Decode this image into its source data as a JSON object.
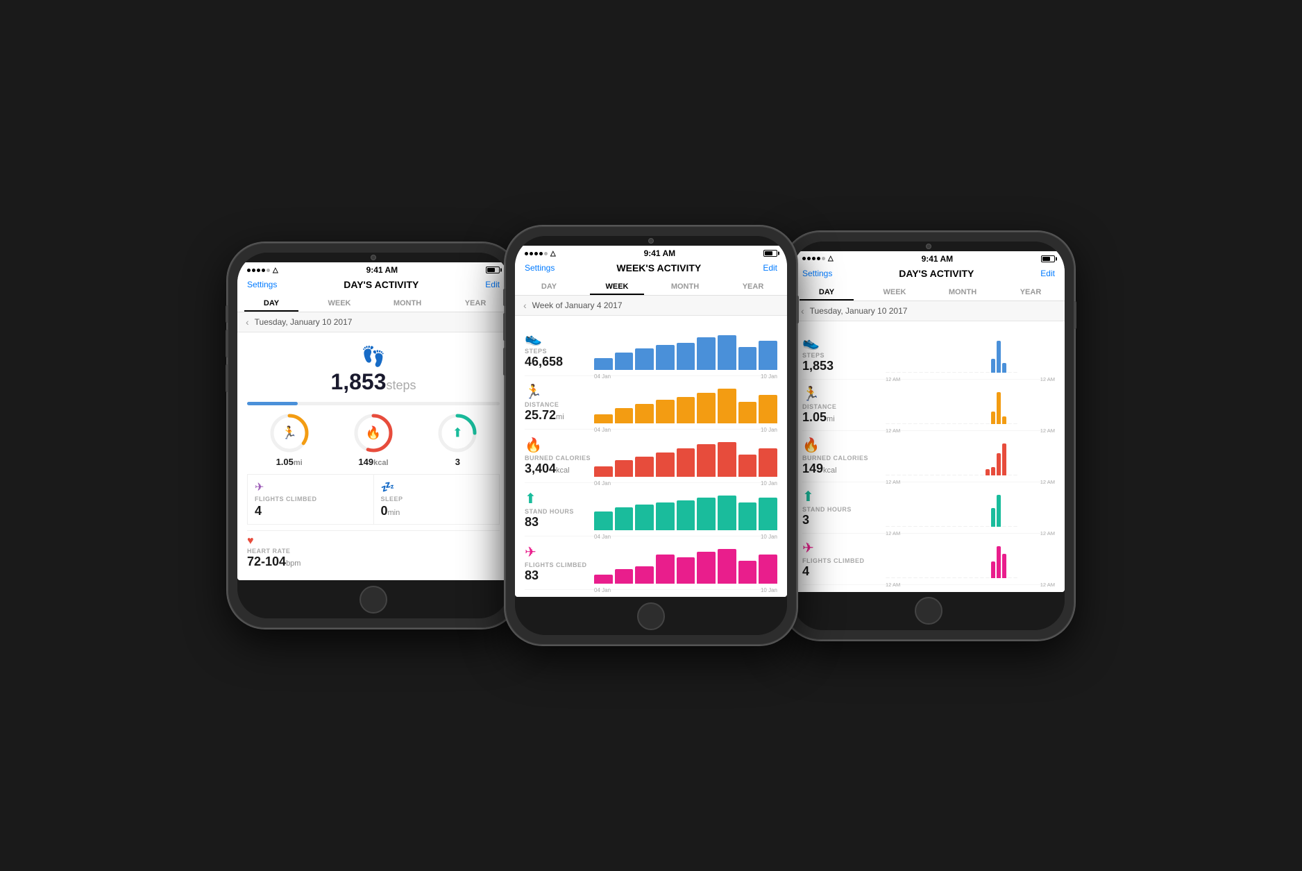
{
  "phones": [
    {
      "id": "phone1",
      "statusBar": {
        "dots": 5,
        "wifi": "WiFi",
        "time": "9:41 AM",
        "battery": 70
      },
      "nav": {
        "settings": "Settings",
        "title": "DAY'S ACTIVITY",
        "edit": "Edit"
      },
      "tabs": [
        "DAY",
        "WEEK",
        "MONTH",
        "YEAR"
      ],
      "activeTab": 0,
      "date": "Tuesday, January 10 2017",
      "hero": {
        "steps": "1,853",
        "label": "steps",
        "progress": 20
      },
      "metrics": [
        {
          "value": "1.05",
          "unit": "mi",
          "color": "#f39c12",
          "percent": 35,
          "icon": "🏃"
        },
        {
          "value": "149",
          "unit": "kcal",
          "color": "#e74c3c",
          "percent": 55,
          "icon": "🔥"
        },
        {
          "value": "3",
          "unit": "",
          "color": "#1abc9c",
          "percent": 25,
          "icon": "⬆"
        }
      ],
      "smallMetrics": [
        {
          "icon": "✈",
          "iconColor": "#9b59b6",
          "label": "FLIGHTS CLIMBED",
          "value": "4",
          "unit": ""
        },
        {
          "icon": "💤",
          "iconColor": "#4a90d9",
          "label": "SLEEP",
          "value": "0",
          "unit": "min"
        }
      ],
      "heartRate": {
        "icon": "♥",
        "label": "HEART RATE",
        "value": "72-104",
        "unit": "bpm"
      }
    },
    {
      "id": "phone2",
      "statusBar": {
        "dots": 5,
        "wifi": "WiFi",
        "time": "9:41 AM",
        "battery": 70
      },
      "nav": {
        "settings": "Settings",
        "title": "WEEK'S ACTIVITY",
        "edit": "Edit"
      },
      "tabs": [
        "DAY",
        "WEEK",
        "MONTH",
        "YEAR"
      ],
      "activeTab": 1,
      "date": "Week of January 4 2017",
      "weekRows": [
        {
          "icon": "👟",
          "iconColor": "#4a90d9",
          "label": "STEPS",
          "value": "46,658",
          "unit": "",
          "color": "#4a90d9",
          "bars": [
            30,
            45,
            55,
            65,
            70,
            85,
            90,
            60,
            75
          ],
          "dateStart": "04 Jan",
          "dateEnd": "10 Jan"
        },
        {
          "icon": "🏃",
          "iconColor": "#f39c12",
          "label": "DISTANCE",
          "value": "25.72",
          "unit": "mi",
          "color": "#f39c12",
          "bars": [
            20,
            35,
            45,
            55,
            60,
            70,
            80,
            50,
            65
          ],
          "dateStart": "04 Jan",
          "dateEnd": "10 Jan"
        },
        {
          "icon": "🔥",
          "iconColor": "#e74c3c",
          "label": "BURNED CALORIES",
          "value": "3,404",
          "unit": "kcal",
          "color": "#e74c3c",
          "bars": [
            25,
            40,
            50,
            60,
            70,
            80,
            85,
            55,
            70
          ],
          "dateStart": "04 Jan",
          "dateEnd": "10 Jan"
        },
        {
          "icon": "⬆",
          "iconColor": "#1abc9c",
          "label": "STAND HOURS",
          "value": "83",
          "unit": "",
          "color": "#1abc9c",
          "bars": [
            40,
            50,
            55,
            60,
            65,
            70,
            75,
            60,
            70
          ],
          "dateStart": "04 Jan",
          "dateEnd": "10 Jan"
        },
        {
          "icon": "✈",
          "iconColor": "#e91e8c",
          "label": "FLIGHTS CLIMBED",
          "value": "83",
          "unit": "",
          "color": "#e91e8c",
          "bars": [
            15,
            25,
            30,
            50,
            45,
            55,
            60,
            40,
            50
          ],
          "dateStart": "04 Jan",
          "dateEnd": "10 Jan"
        }
      ]
    },
    {
      "id": "phone3",
      "statusBar": {
        "dots": 5,
        "wifi": "WiFi",
        "time": "9:41 AM",
        "battery": 70
      },
      "nav": {
        "settings": "Settings",
        "title": "DAY'S ACTIVITY",
        "edit": "Edit"
      },
      "tabs": [
        "DAY",
        "WEEK",
        "MONTH",
        "YEAR"
      ],
      "activeTab": 0,
      "date": "Tuesday, January 10 2017",
      "dayRows": [
        {
          "icon": "👟",
          "iconColor": "#4a90d9",
          "label": "STEPS",
          "value": "1,853",
          "unit": "",
          "color": "#4a90d9",
          "bars": [
            0,
            0,
            0,
            0,
            0,
            0,
            0,
            0,
            0,
            0,
            0,
            0,
            0,
            0,
            0,
            0,
            0,
            0,
            0,
            30,
            70,
            20,
            0,
            0
          ],
          "labelStart": "12 AM",
          "labelEnd": "12 AM"
        },
        {
          "icon": "🏃",
          "iconColor": "#f39c12",
          "label": "DISTANCE",
          "value": "1.05",
          "unit": "mi",
          "color": "#f39c12",
          "bars": [
            0,
            0,
            0,
            0,
            0,
            0,
            0,
            0,
            0,
            0,
            0,
            0,
            0,
            0,
            0,
            0,
            0,
            0,
            0,
            25,
            65,
            15,
            0,
            0
          ],
          "labelStart": "12 AM",
          "labelEnd": "12 AM"
        },
        {
          "icon": "🔥",
          "iconColor": "#e74c3c",
          "label": "BURNED CALORIES",
          "value": "149",
          "unit": "kcal",
          "color": "#e74c3c",
          "bars": [
            0,
            0,
            0,
            0,
            0,
            0,
            0,
            0,
            0,
            0,
            0,
            0,
            0,
            0,
            0,
            0,
            0,
            0,
            15,
            20,
            55,
            80,
            0,
            0
          ],
          "labelStart": "12 AM",
          "labelEnd": "12 AM"
        },
        {
          "icon": "⬆",
          "iconColor": "#1abc9c",
          "label": "STAND HOURS",
          "value": "3",
          "unit": "",
          "color": "#1abc9c",
          "bars": [
            0,
            0,
            0,
            0,
            0,
            0,
            0,
            0,
            0,
            0,
            0,
            0,
            0,
            0,
            0,
            0,
            0,
            0,
            0,
            40,
            70,
            0,
            0,
            0
          ],
          "labelStart": "12 AM",
          "labelEnd": "12 AM"
        },
        {
          "icon": "✈",
          "iconColor": "#e91e8c",
          "label": "FLIGHTS CLIMBED",
          "value": "4",
          "unit": "",
          "color": "#e91e8c",
          "bars": [
            0,
            0,
            0,
            0,
            0,
            0,
            0,
            0,
            0,
            0,
            0,
            0,
            0,
            0,
            0,
            0,
            0,
            0,
            0,
            30,
            60,
            45,
            0,
            0
          ],
          "labelStart": "12 AM",
          "labelEnd": "12 AM"
        }
      ]
    }
  ],
  "icons": {
    "footprints": "👣",
    "run": "🏃",
    "flame": "🔥",
    "arrow_up": "⬆️",
    "stairs": "🪜",
    "sleep": "💤",
    "heart": "❤️",
    "chevron_left": "‹",
    "wifi": "▲"
  }
}
